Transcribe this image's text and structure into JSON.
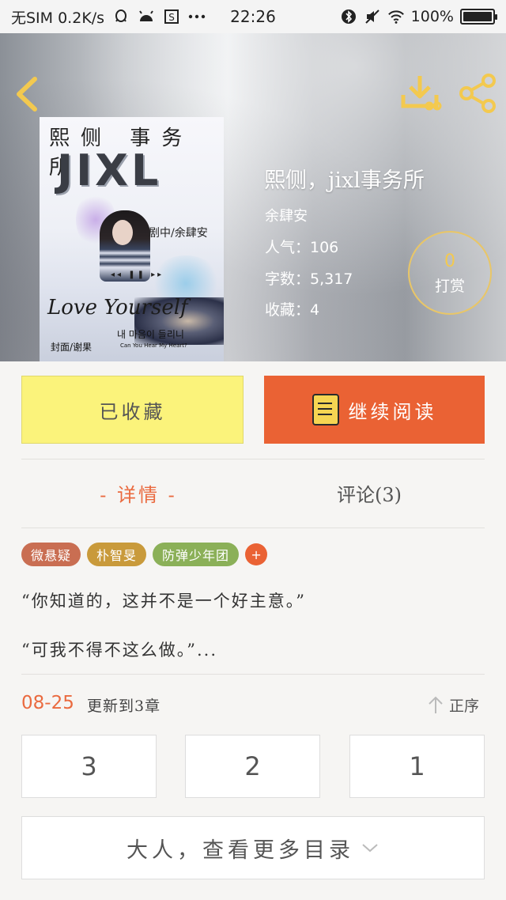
{
  "status_bar": {
    "carrier": "无SIM 0.2K/s",
    "time": "22:26",
    "battery": "100%",
    "battery_level": 1.0,
    "icons": [
      "qq-icon",
      "android-icon",
      "s-icon",
      "more-dots-icon",
      "bluetooth-icon",
      "mute-icon",
      "wifi-icon",
      "battery-icon"
    ]
  },
  "header": {
    "back_icon": "chevron-left-icon",
    "download_icon": "download-icon",
    "share_icon": "share-icon",
    "accent_color": "#f3c94f"
  },
  "cover": {
    "title_cn": "熙侧 事务所",
    "logo": "JIXL",
    "caption": "剧中/余肆安",
    "controls": "◂◂ ❚❚ ▸▸",
    "love_text": "Love Yourself",
    "korean": "내 마음이 들리니",
    "korean_sub": "Can You Hear My Heart?",
    "credit": "封面/谢果"
  },
  "book": {
    "title": "熙侧，jixl事务所",
    "author": "余肆安",
    "popularity": "人气：106",
    "word_count": "字数：5,317",
    "favorites": "收藏：4"
  },
  "tip": {
    "count": "0",
    "label": "打赏"
  },
  "actions": {
    "collected_label": "已收藏",
    "read_label": "继续阅读",
    "read_color": "#ea6234",
    "collected_color": "#fbf37b"
  },
  "tabs": {
    "detail": "- 详情 -",
    "comments": "评论(3)"
  },
  "tags": [
    {
      "label": "微悬疑",
      "color": "#c96e52"
    },
    {
      "label": "朴智旻",
      "color": "#c99a3b"
    },
    {
      "label": "防弹少年团",
      "color": "#8bb058"
    }
  ],
  "tag_add": "+",
  "summary": {
    "line1": "“你知道的，这并不是一个好主意。”",
    "line2": "“可我不得不这么做。”..."
  },
  "update": {
    "date": "08-25",
    "text": "更新到3章",
    "order_label": "正序"
  },
  "chapters": [
    "3",
    "2",
    "1"
  ],
  "more_label": "大人，查看更多目录"
}
